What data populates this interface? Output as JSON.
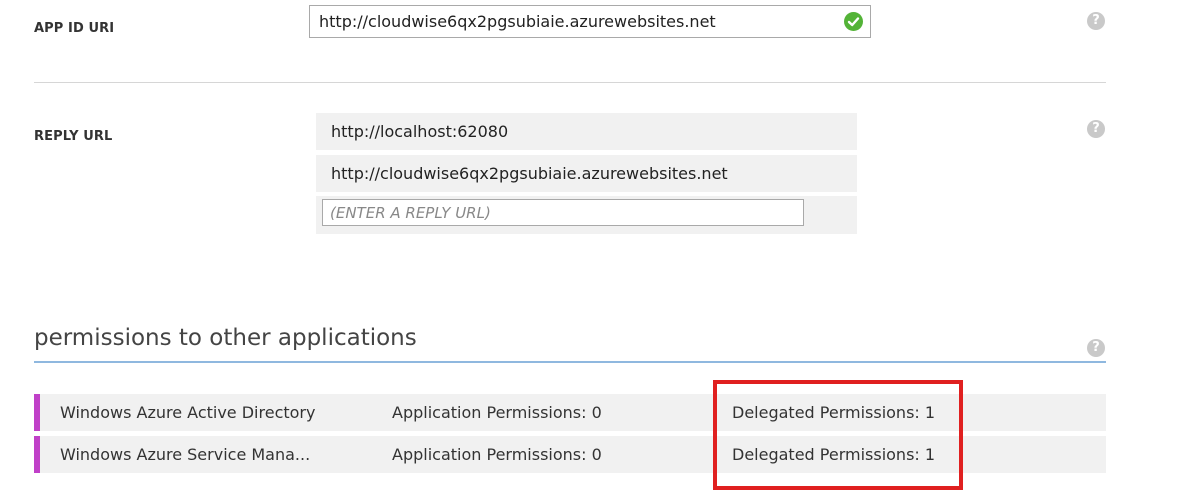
{
  "app_id_uri": {
    "label": "APP ID URI",
    "value": "http://cloudwise6qx2pgsubiaie.azurewebsites.net"
  },
  "reply_url": {
    "label": "REPLY URL",
    "urls": [
      "http://localhost:62080",
      "http://cloudwise6qx2pgsubiaie.azurewebsites.net"
    ],
    "placeholder": "(ENTER A REPLY URL)"
  },
  "help_glyph": "?",
  "permissions": {
    "heading": "permissions to other applications",
    "rows": [
      {
        "app": "Windows Azure Active Directory",
        "application_permissions": "Application Permissions: 0",
        "delegated_permissions": "Delegated Permissions: 1"
      },
      {
        "app": "Windows Azure Service Mana...",
        "application_permissions": "Application Permissions: 0",
        "delegated_permissions": "Delegated Permissions: 1"
      }
    ]
  },
  "colors": {
    "accent_bar": "#c040c8",
    "valid_check": "#53b337",
    "highlight": "#e02020",
    "section_rule": "#8fb8df"
  },
  "icons": {
    "valid": "check-circle-icon",
    "help": "help-question-icon"
  }
}
